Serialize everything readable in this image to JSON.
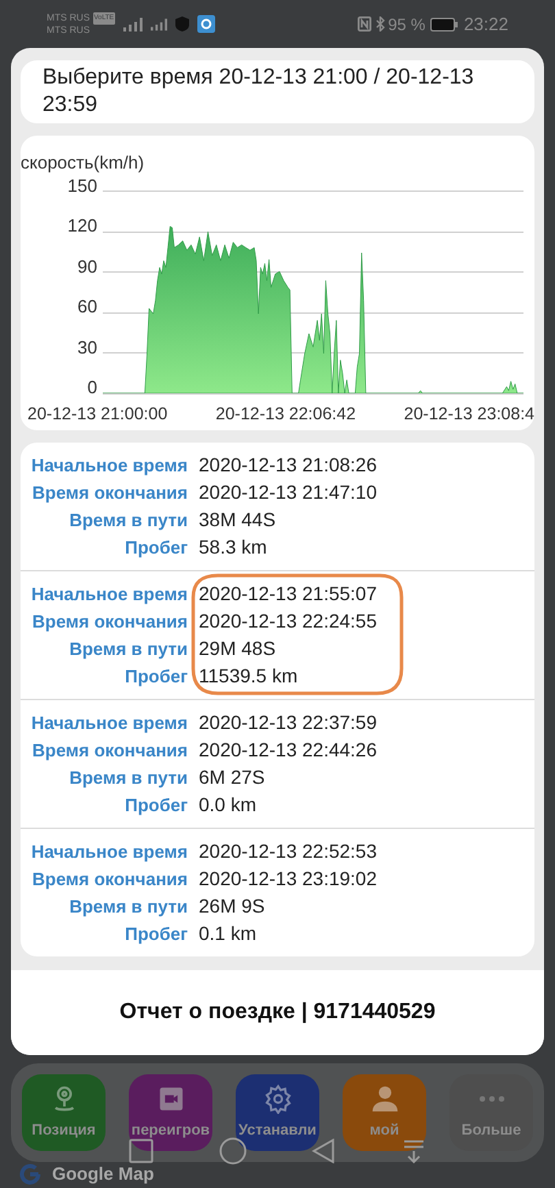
{
  "status_bar": {
    "carrier_1": "MTS RUS",
    "carrier_1_badge": "VoLTE",
    "carrier_2": "MTS RUS",
    "battery": "95 %",
    "time": "23:22"
  },
  "dialog": {
    "time_range": "Выберите время 20-12-13 21:00  /  20-12-13 23:59",
    "chart": {
      "ylabel": "скорость(km/h)",
      "yticks": [
        "150",
        "120",
        "90",
        "60",
        "30",
        "0"
      ],
      "xticks": [
        "20-12-13 21:00:00",
        "20-12-13 22:06:42",
        "20-12-13 23:08:4"
      ]
    },
    "trips": [
      {
        "start_label": "Начальное время",
        "start": "2020-12-13 21:08:26",
        "end_label": "Время окончания",
        "end": "2020-12-13 21:47:10",
        "duration_label": "Время в пути",
        "duration": "38M 44S",
        "distance_label": "Пробег",
        "distance": "58.3 km",
        "circled": false
      },
      {
        "start_label": "Начальное время",
        "start": "2020-12-13 21:55:07",
        "end_label": "Время окончания",
        "end": "2020-12-13 22:24:55",
        "duration_label": "Время в пути",
        "duration": "29M 48S",
        "distance_label": "Пробег",
        "distance": "11539.5 km",
        "circled": true
      },
      {
        "start_label": "Начальное время",
        "start": "2020-12-13 22:37:59",
        "end_label": "Время окончания",
        "end": "2020-12-13 22:44:26",
        "duration_label": "Время в пути",
        "duration": "6M 27S",
        "distance_label": "Пробег",
        "distance": "0.0 km",
        "circled": false
      },
      {
        "start_label": "Начальное время",
        "start": "2020-12-13 22:52:53",
        "end_label": "Время окончания",
        "end": "2020-12-13 23:19:02",
        "duration_label": "Время в пути",
        "duration": "26M 9S",
        "distance_label": "Пробег",
        "distance": "0.1 km",
        "circled": false
      }
    ],
    "footer": "Отчет о поездке | 9171440529"
  },
  "tab_bar": [
    {
      "label": "Позиция",
      "kind": "pin",
      "color": "#1f5a24"
    },
    {
      "label": "переигров",
      "kind": "video",
      "color": "#5a1d5e"
    },
    {
      "label": "Устанавли",
      "kind": "gear",
      "color": "#1c2f72"
    },
    {
      "label": "мой",
      "kind": "person",
      "color": "#8a4a0c"
    },
    {
      "label": "Больше",
      "kind": "more",
      "color": "#4e4e4e"
    }
  ],
  "map_label": "Google Map"
}
